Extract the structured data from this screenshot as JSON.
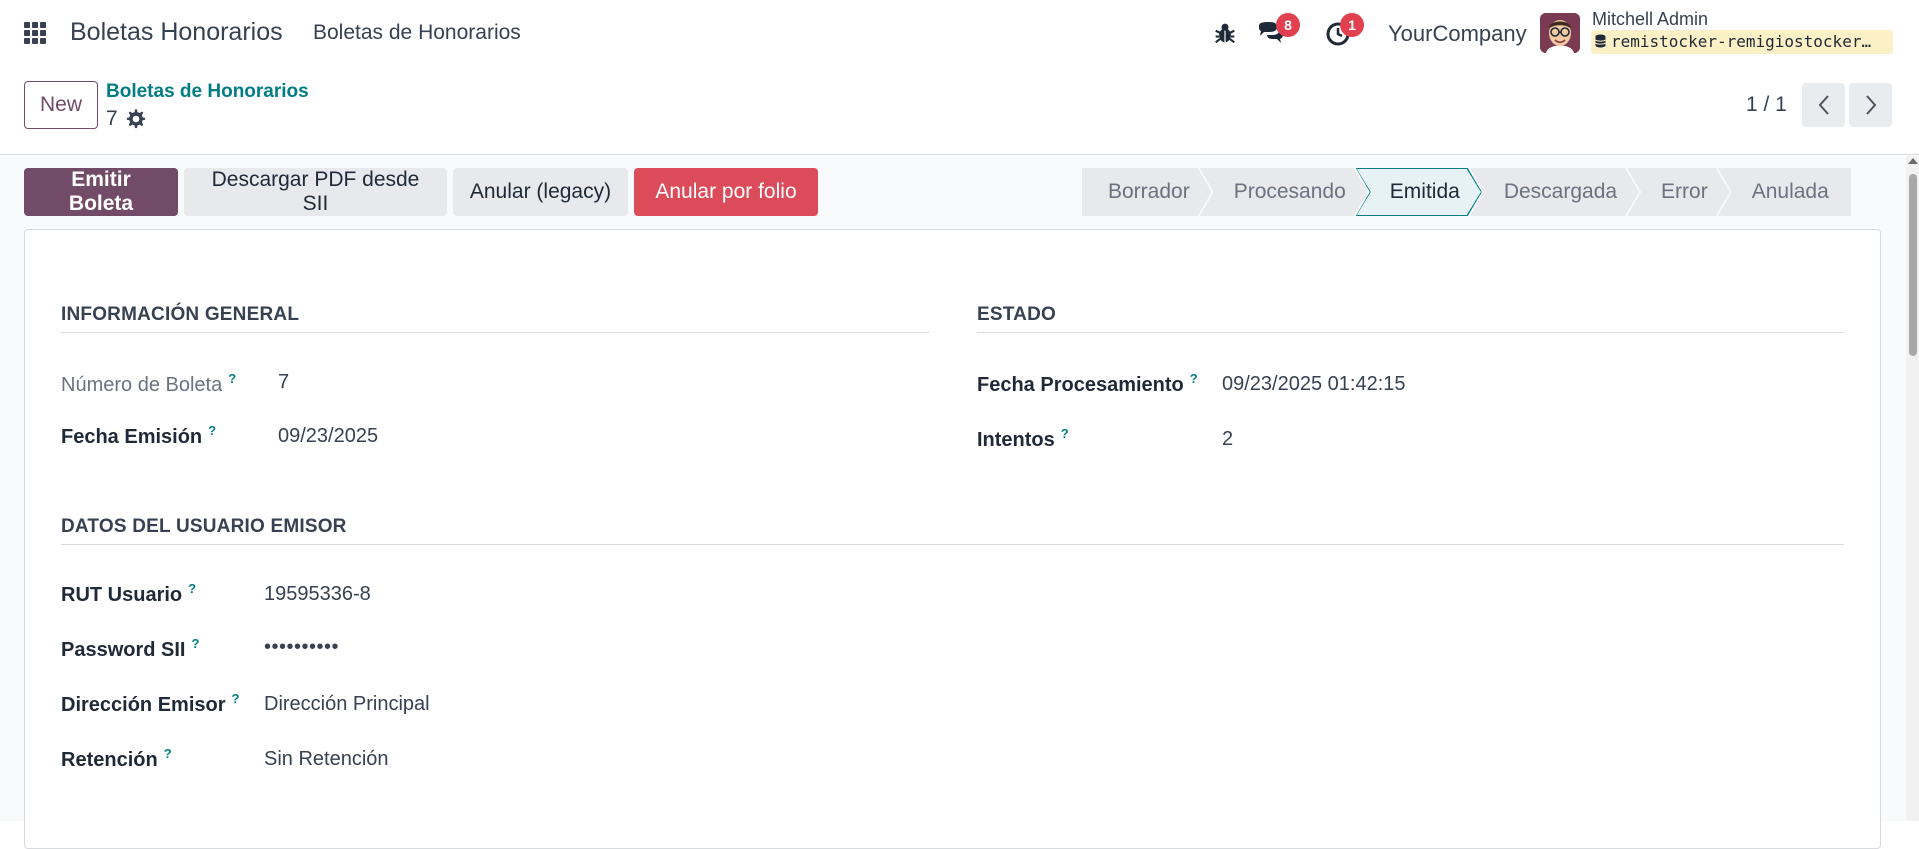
{
  "navbar": {
    "app_title": "Boletas Honorarios",
    "menu_item": "Boletas de Honorarios",
    "messages_count": "8",
    "activities_count": "1",
    "company": "YourCompany",
    "user_name": "Mitchell Admin",
    "database": "remistocker-remigiostocker…"
  },
  "control_panel": {
    "new_label": "New",
    "breadcrumb_link": "Boletas de Honorarios",
    "record_name": "7",
    "pager_value": "1 / 1"
  },
  "actions": {
    "emitir": "Emitir Boleta",
    "descargar": "Descargar PDF desde SII",
    "anular_legacy": "Anular (legacy)",
    "anular_folio": "Anular por folio"
  },
  "statusbar": {
    "stages": [
      "Borrador",
      "Procesando",
      "Emitida",
      "Descargada",
      "Error",
      "Anulada"
    ],
    "active": "Emitida"
  },
  "sections": {
    "general": {
      "title": "INFORMACIÓN GENERAL",
      "numero_label": "Número de Boleta",
      "numero_value": "7",
      "fecha_emision_label": "Fecha Emisión",
      "fecha_emision_value": "09/23/2025"
    },
    "estado": {
      "title": "ESTADO",
      "fecha_proc_label": "Fecha Procesamiento",
      "fecha_proc_value": "09/23/2025 01:42:15",
      "intentos_label": "Intentos",
      "intentos_value": "2"
    },
    "emisor": {
      "title": "DATOS DEL USUARIO EMISOR",
      "rut_label": "RUT Usuario",
      "rut_value": "19595336-8",
      "password_label": "Password SII",
      "password_value": "••••••••••",
      "direccion_label": "Dirección Emisor",
      "direccion_value": "Dirección Principal",
      "retencion_label": "Retención",
      "retencion_value": "Sin Retención"
    }
  },
  "help_marker": "?",
  "colors": {
    "primary": "#714b67",
    "accent": "#017e84",
    "danger": "#dc4b5a",
    "badge": "#e0404f"
  }
}
